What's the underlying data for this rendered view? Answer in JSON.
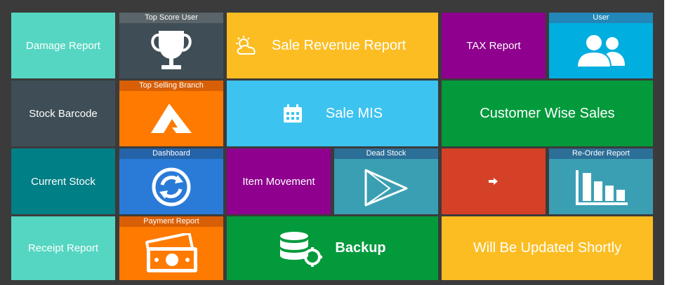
{
  "tiles": {
    "damage_report": "Damage Report",
    "top_score_user": "Top Score User",
    "sale_revenue_report": "Sale Revenue Report",
    "tax_report": "TAX Report",
    "user": "User",
    "stock_barcode": "Stock Barcode",
    "top_selling_branch": "Top Selling Branch",
    "sale_mis": "Sale MIS",
    "customer_wise_sales": "Customer Wise Sales",
    "current_stock": "Current Stock",
    "dashboard": "Dashboard",
    "item_movement": "Item Movement",
    "dead_stock": "Dead Stock",
    "reorder_report": "Re-Order Report",
    "receipt_report": "Receipt Report",
    "payment_report": "Payment Report",
    "backup": "Backup",
    "updated_shortly": "Will Be Updated Shortly"
  },
  "colors": {
    "frame": "#3b3b3b",
    "turquoise": "#55d6c2",
    "slate": "#3f4e56",
    "slate_header": "#5b6469",
    "yellow": "#fbbd22",
    "purple": "#8e008d",
    "sky": "#00aee0",
    "sky_header": "#2287b8",
    "orange": "#ff7a00",
    "orange_header": "#d95f06",
    "light_blue": "#3dc3f0",
    "green": "#039a3c",
    "teal": "#007f86",
    "blue": "#2a7bd8",
    "blue_header": "#2563a8",
    "steel": "#3b9fb3",
    "steel_header": "#2c6f97",
    "red": "#d54127"
  },
  "icons": {
    "trophy": "trophy-icon",
    "weather": "sun-cloud-icon",
    "users": "users-icon",
    "brand": "logo-a-icon",
    "calendar": "calendar-icon",
    "sync": "sync-icon",
    "play": "play-icon",
    "arrow": "arrow-right-icon",
    "bars": "bar-chart-icon",
    "money": "money-icon",
    "database": "database-gear-icon"
  }
}
